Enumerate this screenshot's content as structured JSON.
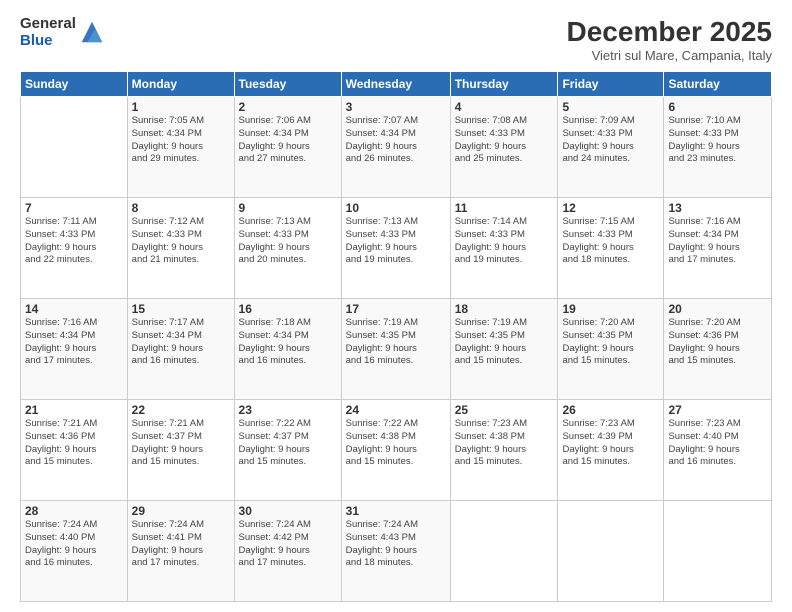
{
  "header": {
    "logo_general": "General",
    "logo_blue": "Blue",
    "month_title": "December 2025",
    "location": "Vietri sul Mare, Campania, Italy"
  },
  "weekdays": [
    "Sunday",
    "Monday",
    "Tuesday",
    "Wednesday",
    "Thursday",
    "Friday",
    "Saturday"
  ],
  "weeks": [
    [
      {
        "day": "",
        "info": ""
      },
      {
        "day": "1",
        "info": "Sunrise: 7:05 AM\nSunset: 4:34 PM\nDaylight: 9 hours\nand 29 minutes."
      },
      {
        "day": "2",
        "info": "Sunrise: 7:06 AM\nSunset: 4:34 PM\nDaylight: 9 hours\nand 27 minutes."
      },
      {
        "day": "3",
        "info": "Sunrise: 7:07 AM\nSunset: 4:34 PM\nDaylight: 9 hours\nand 26 minutes."
      },
      {
        "day": "4",
        "info": "Sunrise: 7:08 AM\nSunset: 4:33 PM\nDaylight: 9 hours\nand 25 minutes."
      },
      {
        "day": "5",
        "info": "Sunrise: 7:09 AM\nSunset: 4:33 PM\nDaylight: 9 hours\nand 24 minutes."
      },
      {
        "day": "6",
        "info": "Sunrise: 7:10 AM\nSunset: 4:33 PM\nDaylight: 9 hours\nand 23 minutes."
      }
    ],
    [
      {
        "day": "7",
        "info": "Sunrise: 7:11 AM\nSunset: 4:33 PM\nDaylight: 9 hours\nand 22 minutes."
      },
      {
        "day": "8",
        "info": "Sunrise: 7:12 AM\nSunset: 4:33 PM\nDaylight: 9 hours\nand 21 minutes."
      },
      {
        "day": "9",
        "info": "Sunrise: 7:13 AM\nSunset: 4:33 PM\nDaylight: 9 hours\nand 20 minutes."
      },
      {
        "day": "10",
        "info": "Sunrise: 7:13 AM\nSunset: 4:33 PM\nDaylight: 9 hours\nand 19 minutes."
      },
      {
        "day": "11",
        "info": "Sunrise: 7:14 AM\nSunset: 4:33 PM\nDaylight: 9 hours\nand 19 minutes."
      },
      {
        "day": "12",
        "info": "Sunrise: 7:15 AM\nSunset: 4:33 PM\nDaylight: 9 hours\nand 18 minutes."
      },
      {
        "day": "13",
        "info": "Sunrise: 7:16 AM\nSunset: 4:34 PM\nDaylight: 9 hours\nand 17 minutes."
      }
    ],
    [
      {
        "day": "14",
        "info": "Sunrise: 7:16 AM\nSunset: 4:34 PM\nDaylight: 9 hours\nand 17 minutes."
      },
      {
        "day": "15",
        "info": "Sunrise: 7:17 AM\nSunset: 4:34 PM\nDaylight: 9 hours\nand 16 minutes."
      },
      {
        "day": "16",
        "info": "Sunrise: 7:18 AM\nSunset: 4:34 PM\nDaylight: 9 hours\nand 16 minutes."
      },
      {
        "day": "17",
        "info": "Sunrise: 7:19 AM\nSunset: 4:35 PM\nDaylight: 9 hours\nand 16 minutes."
      },
      {
        "day": "18",
        "info": "Sunrise: 7:19 AM\nSunset: 4:35 PM\nDaylight: 9 hours\nand 15 minutes."
      },
      {
        "day": "19",
        "info": "Sunrise: 7:20 AM\nSunset: 4:35 PM\nDaylight: 9 hours\nand 15 minutes."
      },
      {
        "day": "20",
        "info": "Sunrise: 7:20 AM\nSunset: 4:36 PM\nDaylight: 9 hours\nand 15 minutes."
      }
    ],
    [
      {
        "day": "21",
        "info": "Sunrise: 7:21 AM\nSunset: 4:36 PM\nDaylight: 9 hours\nand 15 minutes."
      },
      {
        "day": "22",
        "info": "Sunrise: 7:21 AM\nSunset: 4:37 PM\nDaylight: 9 hours\nand 15 minutes."
      },
      {
        "day": "23",
        "info": "Sunrise: 7:22 AM\nSunset: 4:37 PM\nDaylight: 9 hours\nand 15 minutes."
      },
      {
        "day": "24",
        "info": "Sunrise: 7:22 AM\nSunset: 4:38 PM\nDaylight: 9 hours\nand 15 minutes."
      },
      {
        "day": "25",
        "info": "Sunrise: 7:23 AM\nSunset: 4:38 PM\nDaylight: 9 hours\nand 15 minutes."
      },
      {
        "day": "26",
        "info": "Sunrise: 7:23 AM\nSunset: 4:39 PM\nDaylight: 9 hours\nand 15 minutes."
      },
      {
        "day": "27",
        "info": "Sunrise: 7:23 AM\nSunset: 4:40 PM\nDaylight: 9 hours\nand 16 minutes."
      }
    ],
    [
      {
        "day": "28",
        "info": "Sunrise: 7:24 AM\nSunset: 4:40 PM\nDaylight: 9 hours\nand 16 minutes."
      },
      {
        "day": "29",
        "info": "Sunrise: 7:24 AM\nSunset: 4:41 PM\nDaylight: 9 hours\nand 17 minutes."
      },
      {
        "day": "30",
        "info": "Sunrise: 7:24 AM\nSunset: 4:42 PM\nDaylight: 9 hours\nand 17 minutes."
      },
      {
        "day": "31",
        "info": "Sunrise: 7:24 AM\nSunset: 4:43 PM\nDaylight: 9 hours\nand 18 minutes."
      },
      {
        "day": "",
        "info": ""
      },
      {
        "day": "",
        "info": ""
      },
      {
        "day": "",
        "info": ""
      }
    ]
  ]
}
